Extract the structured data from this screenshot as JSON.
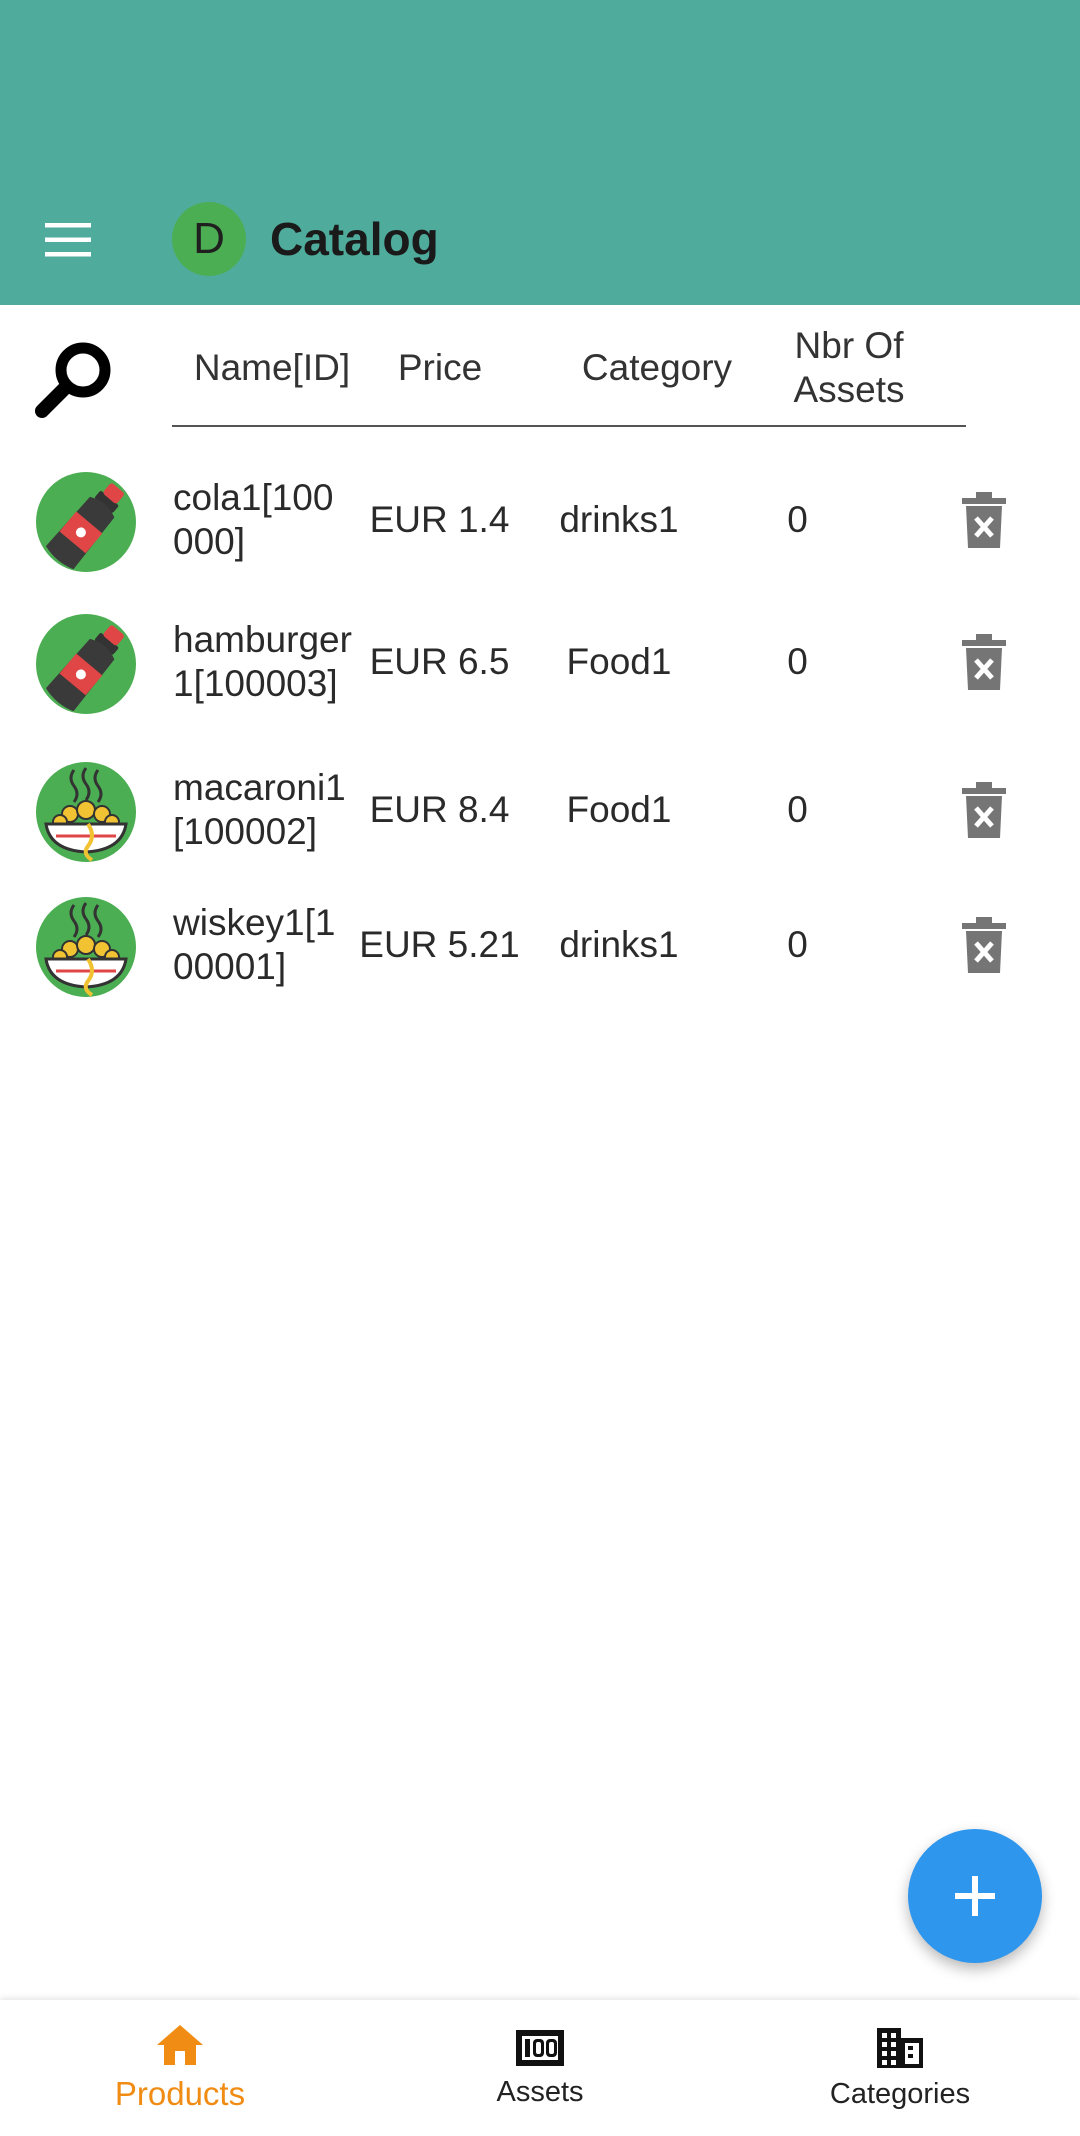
{
  "appbar": {
    "title": "Catalog",
    "avatar_letter": "D",
    "color": "#4fab9b"
  },
  "table": {
    "headers": {
      "name": "Name[ID]",
      "price": "Price",
      "category": "Category",
      "assets": "Nbr Of Assets"
    },
    "rows": [
      {
        "icon": "cola-bottle-icon",
        "name": "cola1[100000]",
        "price": "EUR 1.4",
        "category": "drinks1",
        "assets": "0"
      },
      {
        "icon": "cola-bottle-icon",
        "name": "hamburger1[100003]",
        "price": "EUR 6.5",
        "category": "Food1",
        "assets": "0"
      },
      {
        "icon": "noodles-bowl-icon",
        "name": "macaroni1[100002]",
        "price": "EUR 8.4",
        "category": "Food1",
        "assets": "0"
      },
      {
        "icon": "noodles-bowl-icon",
        "name": "wiskey1[100001]",
        "price": "EUR 5.21",
        "category": "drinks1",
        "assets": "0"
      }
    ]
  },
  "bottom_nav": {
    "items": [
      {
        "label": "Products",
        "icon": "home-icon",
        "active": true
      },
      {
        "label": "Assets",
        "icon": "money-icon",
        "active": false
      },
      {
        "label": "Categories",
        "icon": "building-icon",
        "active": false
      }
    ]
  },
  "colors": {
    "accent": "#f08c14",
    "fab": "#2f96ee",
    "thumb": "#4cae52"
  }
}
